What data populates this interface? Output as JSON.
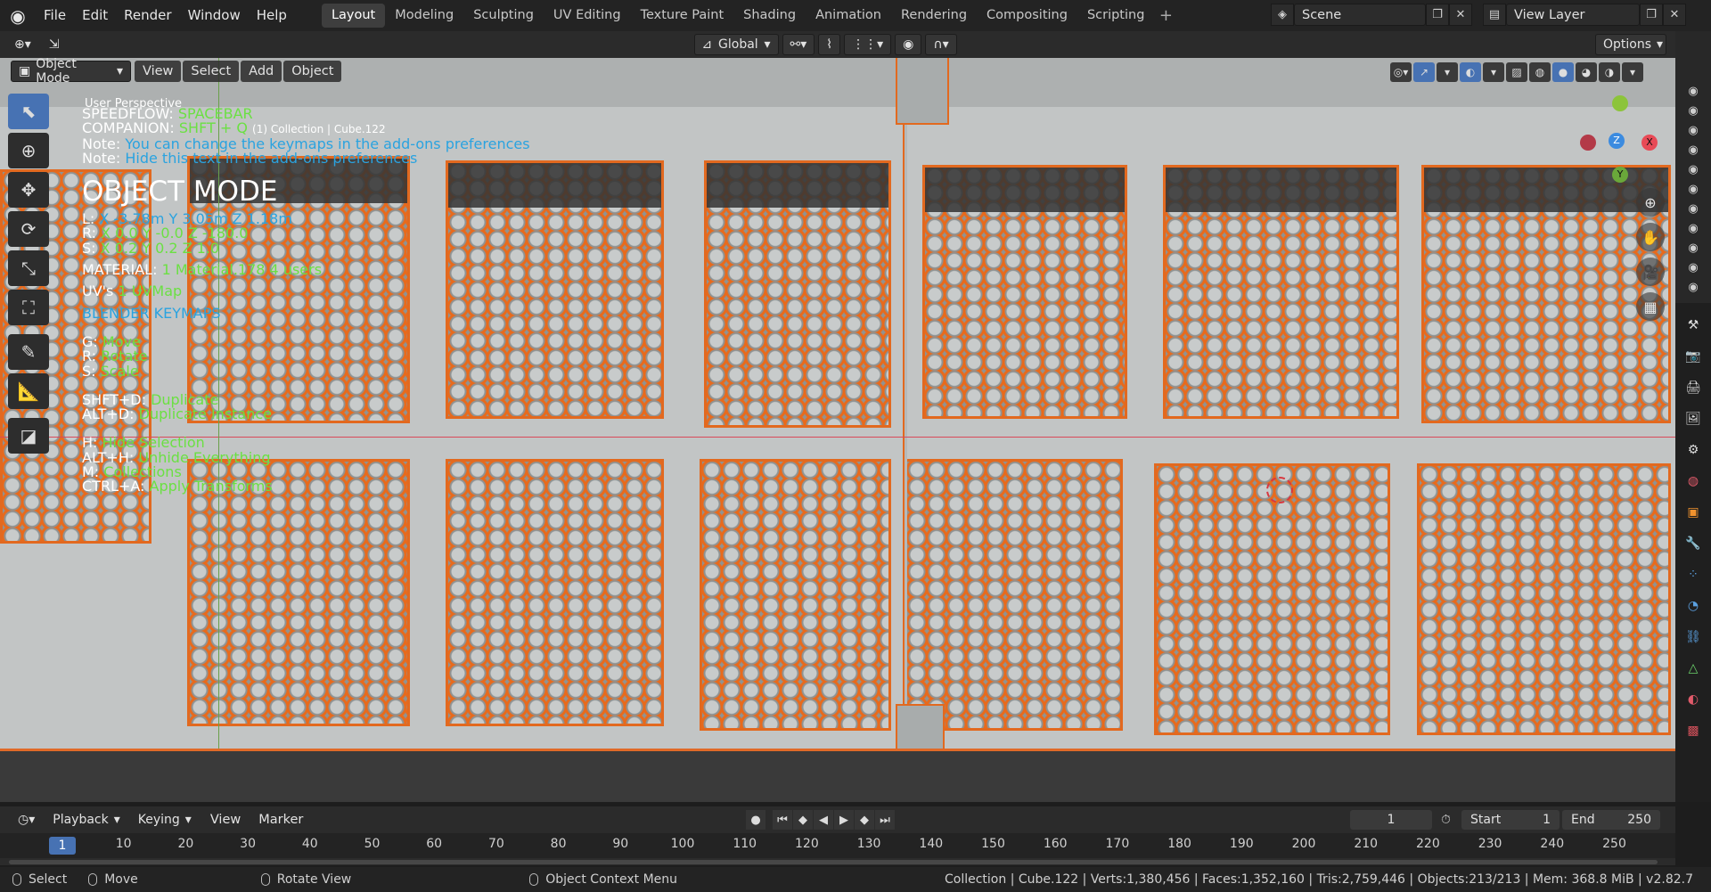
{
  "menu": [
    "File",
    "Edit",
    "Render",
    "Window",
    "Help"
  ],
  "workspaces": [
    "Layout",
    "Modeling",
    "Sculpting",
    "UV Editing",
    "Texture Paint",
    "Shading",
    "Animation",
    "Rendering",
    "Compositing",
    "Scripting"
  ],
  "active_workspace": "Layout",
  "scene": "Scene",
  "view_layer": "View Layer",
  "viewport_header": {
    "transform_orientation": "Global",
    "options_label": "Options",
    "mode": "Object Mode",
    "menus": [
      "View",
      "Select",
      "Add",
      "Object"
    ]
  },
  "overlay": {
    "perspective": "User Perspective",
    "collection": "(1) Collection | Cube.122",
    "speedflow_key": "SPEEDFLOW:",
    "speedflow_val": "SPACEBAR",
    "companion_key": "COMPANION:",
    "companion_val": "SHFT + Q",
    "note1_key": "Note:",
    "note1_val": "You can change the keymaps in the add-ons preferences",
    "note2_key": "Note:",
    "note2_val": "Hide this text in the add-ons preferences",
    "mode_title": "OBJECT MODE",
    "loc_key": "L:",
    "loc_val": "X -3.78m  Y 3.05m  Z 1.18m",
    "rot_key": "R:",
    "rot_val": "X 0.0   Y -0.0   Z -180.0",
    "scale_key": "S:",
    "scale_val": "X 0.2  Y 0.2  Z 1.0",
    "material_key": "MATERIAL:",
    "material_val": "1 Material.178  4 users",
    "uv_key": "UV's",
    "uv_val": "1 UVMap",
    "keymap_label": "BLENDER KEYMAPS",
    "g_key": "G:",
    "g_val": "Move",
    "r_key": "R:",
    "r_val": "Rotate",
    "s_key": "S:",
    "s_val": "Scale",
    "dup_key": "SHFT+D:",
    "dup_val": "Duplicate",
    "inst_key": "ALT+D:",
    "inst_val": "Duplicate Instance",
    "hide_key": "H:",
    "hide_val": "Hide Selection",
    "unhide_key": "ALT+H:",
    "unhide_val": "Unhide Everything",
    "coll_key": "M:",
    "coll_val": "Collections",
    "apply_key": "CTRL+A:",
    "apply_val": "Apply Transforms"
  },
  "gizmo": {
    "x": "X",
    "y": "Y",
    "z": "Z"
  },
  "timeline": {
    "menus": [
      "Playback",
      "Keying",
      "View",
      "Marker"
    ],
    "current_frame": "1",
    "start_label": "Start",
    "start": "1",
    "end_label": "End",
    "end": "250",
    "ruler_current": "1",
    "ticks": [
      "10",
      "20",
      "30",
      "40",
      "50",
      "60",
      "70",
      "80",
      "90",
      "100",
      "110",
      "120",
      "130",
      "140",
      "150",
      "160",
      "170",
      "180",
      "190",
      "200",
      "210",
      "220",
      "230",
      "240",
      "250"
    ]
  },
  "status": {
    "select": "Select",
    "move": "Move",
    "rotate": "Rotate View",
    "context": "Object Context Menu",
    "stats": "Collection | Cube.122 | Verts:1,380,456 | Faces:1,352,160 | Tris:2,759,446 | Objects:213/213 | Mem: 368.8 MiB | v2.82.7"
  },
  "colors": {
    "accent": "#4772b3",
    "selection": "#e2691f",
    "overlay_value": "#6be043",
    "overlay_note": "#2aa3e0"
  }
}
